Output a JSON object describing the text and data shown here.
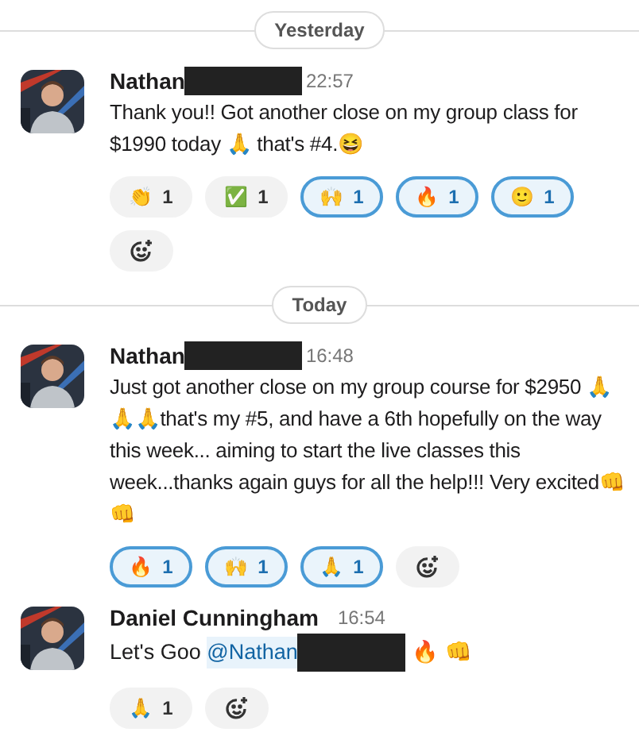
{
  "feed": [
    {
      "kind": "divider",
      "label": "Yesterday"
    },
    {
      "kind": "message",
      "author": "Nathan",
      "redacted": true,
      "time": "22:57",
      "text": "Thank you!! Got another close on my group class for $1990 today 🙏 that's #4.😆",
      "reactions": [
        {
          "emoji": "👏",
          "count": "1",
          "selected": false
        },
        {
          "emoji": "✅",
          "count": "1",
          "selected": false
        },
        {
          "emoji": "🙌",
          "count": "1",
          "selected": true
        },
        {
          "emoji": "🔥",
          "count": "1",
          "selected": true
        },
        {
          "emoji": "🙂",
          "count": "1",
          "selected": true
        }
      ]
    },
    {
      "kind": "divider",
      "label": "Today"
    },
    {
      "kind": "message",
      "author": "Nathan",
      "redacted": true,
      "time": "16:48",
      "text": "Just got another close on my group course for $2950 🙏🙏🙏that's my #5, and have a 6th hopefully on the way this week... aiming to start the live classes this week...thanks again guys for all the help!!! Very excited👊👊",
      "reactions": [
        {
          "emoji": "🔥",
          "count": "1",
          "selected": true
        },
        {
          "emoji": "🙌",
          "count": "1",
          "selected": true
        },
        {
          "emoji": "🙏",
          "count": "1",
          "selected": true
        }
      ]
    },
    {
      "kind": "message",
      "author": "Daniel Cunningham",
      "redacted": false,
      "time": "16:54",
      "text_before": "Let's Goo ",
      "mention": "@Nathan",
      "mention_redacted": true,
      "text_after": " 🔥 👊",
      "reactions": [
        {
          "emoji": "🙏",
          "count": "1",
          "selected": false
        }
      ]
    }
  ]
}
